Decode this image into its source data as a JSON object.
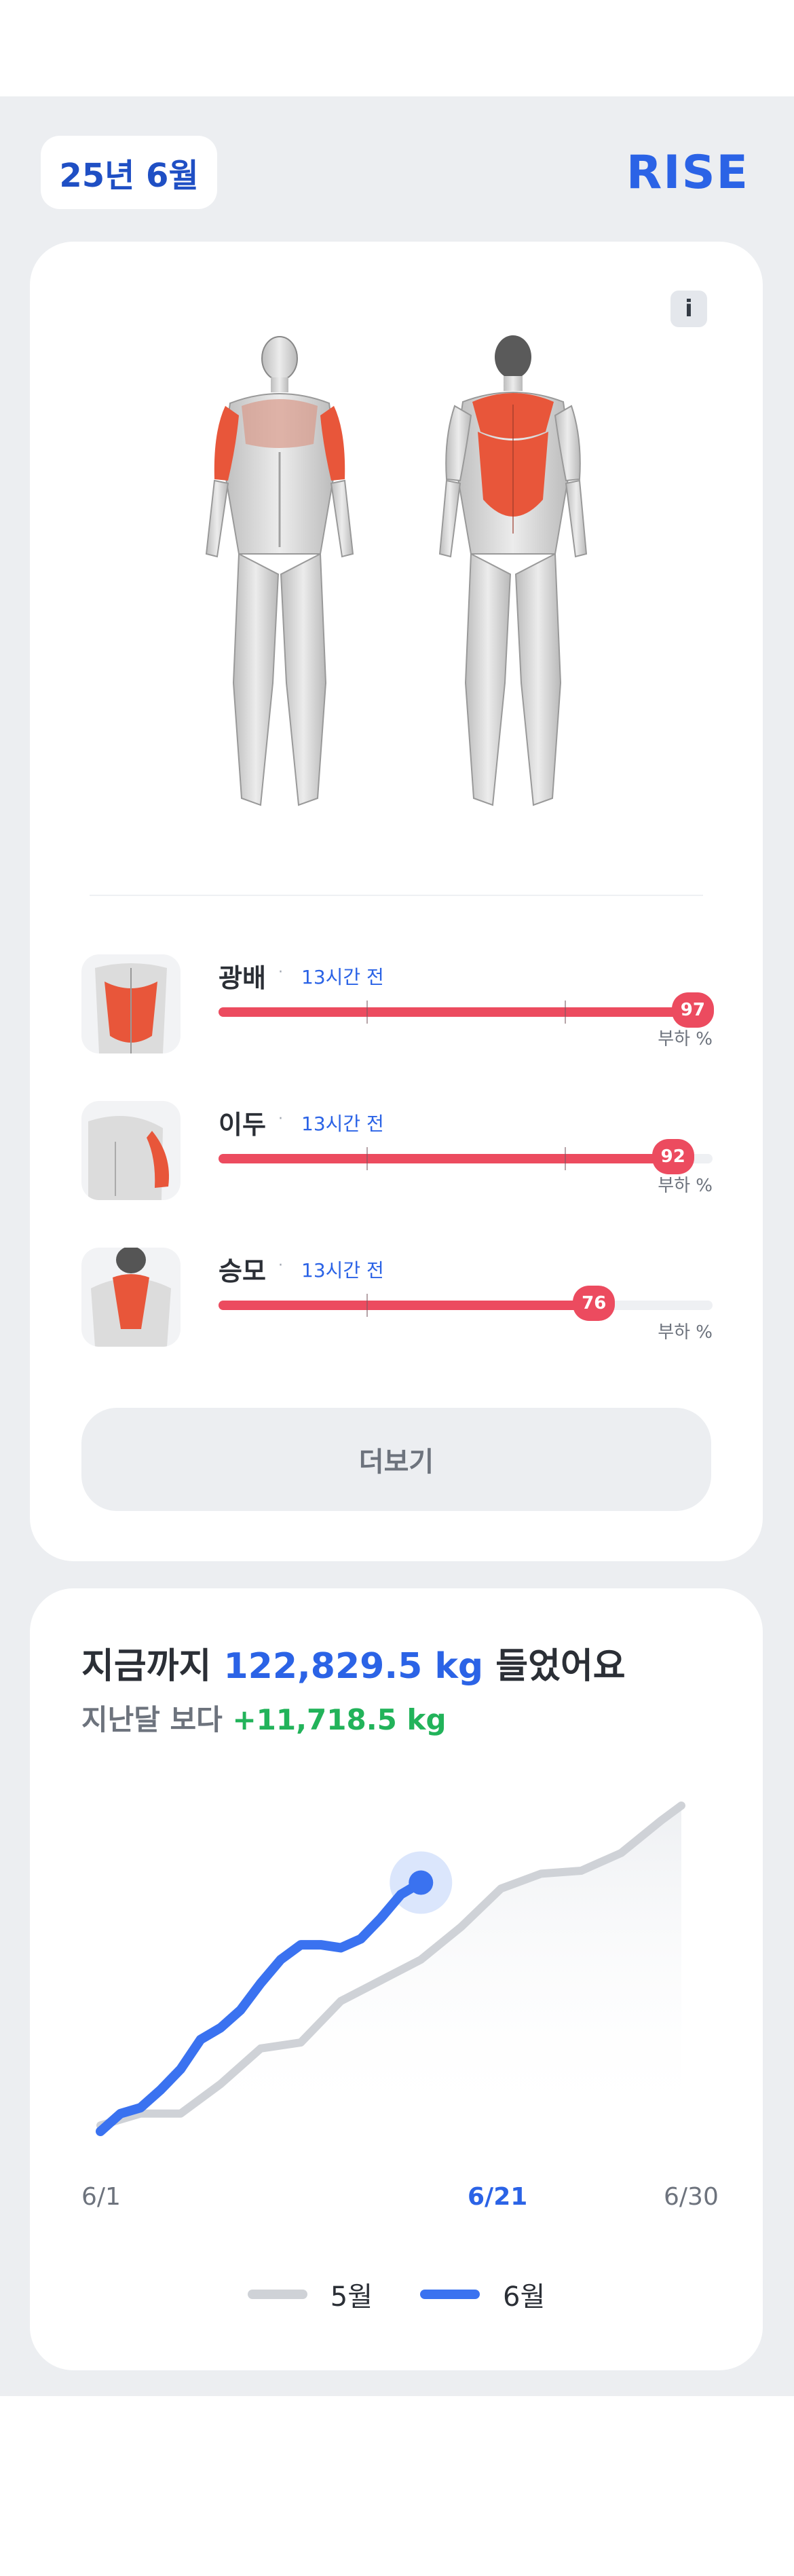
{
  "header": {
    "month_label": "25년 6월",
    "brand": "RISE"
  },
  "muscle_card": {
    "info_label": "i",
    "muscles": [
      {
        "name": "광배",
        "time": "13시간 전",
        "load": 97,
        "load_label": "97",
        "unit": "부하 %",
        "thumb_icon": "lats-thumbnail-icon"
      },
      {
        "name": "이두",
        "time": "13시간 전",
        "load": 92,
        "load_label": "92",
        "unit": "부하 %",
        "thumb_icon": "biceps-thumbnail-icon"
      },
      {
        "name": "승모",
        "time": "13시간 전",
        "load": 76,
        "load_label": "76",
        "unit": "부하 %",
        "thumb_icon": "traps-thumbnail-icon"
      }
    ],
    "more_label": "더보기"
  },
  "summary": {
    "prefix": "지금까지 ",
    "total": "122,829.5 kg",
    "suffix": " 들었어요",
    "diff_prefix": "지난달 보다 ",
    "diff_value": "+11,718.5 kg"
  },
  "chart_data": {
    "type": "line",
    "x": [
      "6/1",
      "6/21",
      "6/30"
    ],
    "x_tick_labels": [
      "6/1",
      "6/21",
      "6/30"
    ],
    "highlight_label": "6/21",
    "series": [
      {
        "name": "5월",
        "color": "#cfd2d7",
        "values": [
          [
            1,
            2
          ],
          [
            3,
            6
          ],
          [
            5,
            6
          ],
          [
            7,
            16
          ],
          [
            9,
            28
          ],
          [
            11,
            30
          ],
          [
            13,
            44
          ],
          [
            15,
            51
          ],
          [
            17,
            58
          ],
          [
            19,
            69
          ],
          [
            21,
            82
          ],
          [
            23,
            87
          ],
          [
            25,
            88
          ],
          [
            27,
            94
          ],
          [
            29,
            105
          ],
          [
            30,
            110
          ]
        ]
      },
      {
        "name": "6월",
        "color": "#3a72f0",
        "values": [
          [
            1,
            0
          ],
          [
            2,
            6
          ],
          [
            3,
            8
          ],
          [
            4,
            14
          ],
          [
            5,
            21
          ],
          [
            6,
            31
          ],
          [
            7,
            35
          ],
          [
            8,
            41
          ],
          [
            9,
            50
          ],
          [
            10,
            58
          ],
          [
            11,
            63
          ],
          [
            12,
            63
          ],
          [
            13,
            62
          ],
          [
            14,
            65
          ],
          [
            15,
            72
          ],
          [
            16,
            80
          ],
          [
            17,
            84
          ]
        ]
      }
    ],
    "ylim": [
      0,
      110
    ],
    "grid": false,
    "legend_position": "bottom-center"
  },
  "colors": {
    "accent": "#2b63e6",
    "muscle_highlight": "#e8563a",
    "load_bar": "#ec4b5f",
    "positive": "#22b35a"
  }
}
